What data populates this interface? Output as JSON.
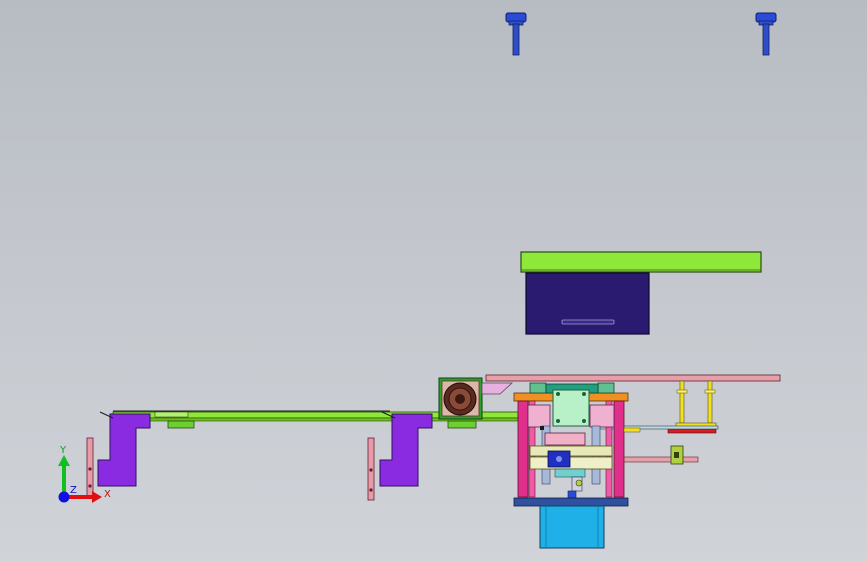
{
  "viewport": {
    "background_top": "#b7bcc3",
    "background_bottom": "#d0d3d8"
  },
  "triad": {
    "y_label": "Y",
    "x_label": "X",
    "z_label": "Z",
    "x_color": "#e01010",
    "y_color": "#10c020",
    "z_color": "#1010e0"
  },
  "colors": {
    "conveyor_green": "#7ee040",
    "bracket_purple": "#8a2be2",
    "motor_box_navy": "#2a1a6e",
    "column_magenta": "#e0308c",
    "base_cyan": "#20b0e8",
    "rail_pink": "#e89aa8",
    "pin_blue": "#2040d0",
    "yellow_post": "#f0e020",
    "orange_plate": "#f09020",
    "steel_blue": "#3050a0"
  }
}
